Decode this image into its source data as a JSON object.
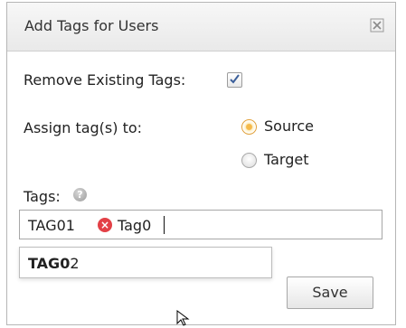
{
  "dialog": {
    "title": "Add Tags for Users",
    "icons": {
      "close": "close-icon"
    }
  },
  "form": {
    "remove_existing_label": "Remove Existing Tags:",
    "remove_existing_checked": true,
    "assign_label": "Assign tag(s) to:",
    "assign_options": [
      {
        "label": "Source",
        "selected": true
      },
      {
        "label": "Target",
        "selected": false
      }
    ],
    "tags_label": "Tags:",
    "help_icon": "help-icon",
    "tag_input": {
      "chips": [
        "TAG01"
      ],
      "typed_text": "Tag0"
    },
    "suggestion": {
      "match": "TAG0",
      "rest": "2"
    },
    "save_label": "Save"
  },
  "colors": {
    "accent_radio": "#f5b94a",
    "remove_tag": "#e34046"
  }
}
